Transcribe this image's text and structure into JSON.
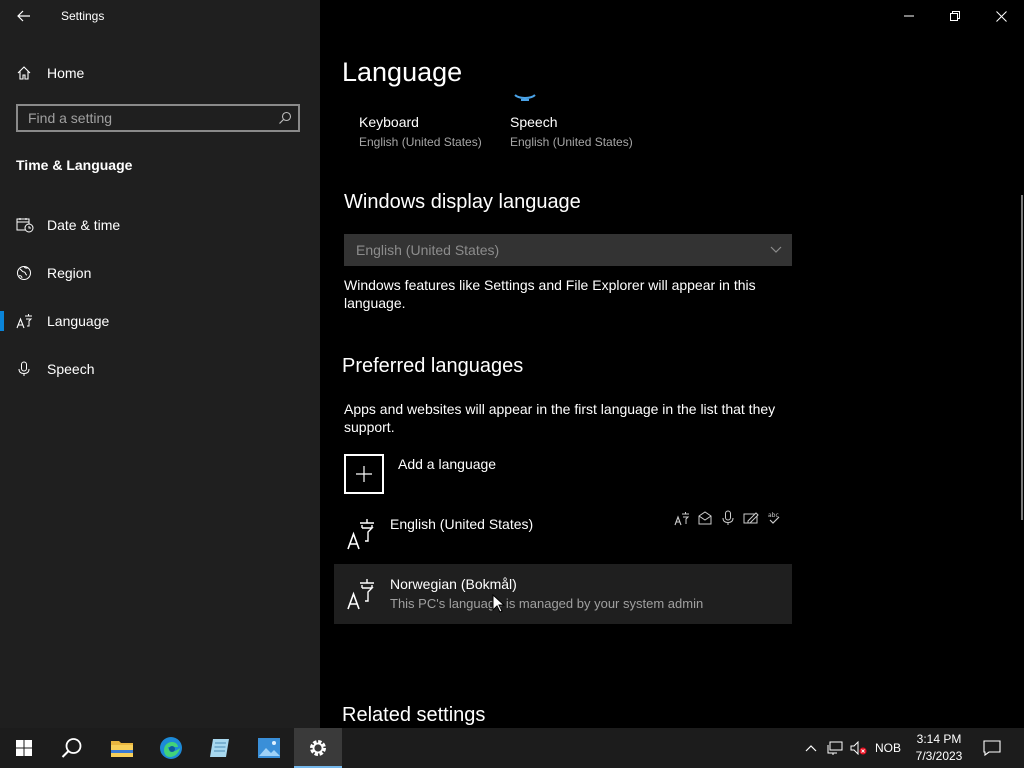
{
  "window": {
    "title": "Settings"
  },
  "sidebar": {
    "home_label": "Home",
    "search_placeholder": "Find a setting",
    "section_title": "Time & Language",
    "items": [
      {
        "label": "Date & time",
        "icon": "calendar-clock-icon"
      },
      {
        "label": "Region",
        "icon": "globe-icon"
      },
      {
        "label": "Language",
        "icon": "language-icon",
        "active": true
      },
      {
        "label": "Speech",
        "icon": "microphone-icon"
      }
    ]
  },
  "main": {
    "page_title": "Language",
    "tiles": [
      {
        "title": "Keyboard",
        "subtitle": "English (United States)"
      },
      {
        "title": "Speech",
        "subtitle": "English (United States)"
      }
    ],
    "display_language": {
      "heading": "Windows display language",
      "selected": "English (United States)",
      "description": "Windows features like Settings and File Explorer will appear in this language."
    },
    "preferred": {
      "heading": "Preferred languages",
      "description": "Apps and websites will appear in the first language in the list that they support.",
      "add_label": "Add a language",
      "languages": [
        {
          "name": "English (United States)",
          "subtitle": ""
        },
        {
          "name": "Norwegian (Bokmål)",
          "subtitle": "This PC's language is managed by your system admin"
        }
      ]
    },
    "related_heading": "Related settings"
  },
  "taskbar": {
    "input_indicator": "NOB",
    "time": "3:14 PM",
    "date": "7/3/2023"
  },
  "colors": {
    "accent": "#0a84d8",
    "sidebar_bg": "#1f1f1f",
    "taskbar_bg": "#1c1c1c"
  }
}
